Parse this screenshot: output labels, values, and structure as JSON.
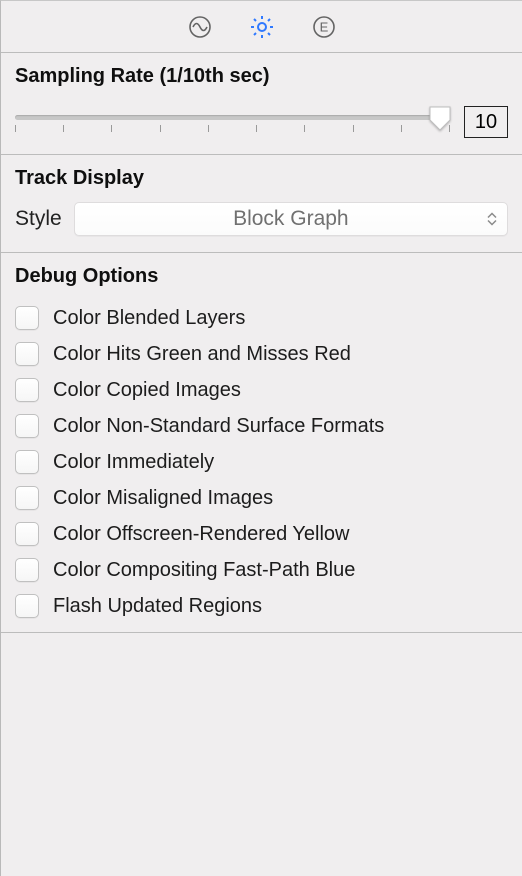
{
  "toolbar": {
    "tabs": [
      {
        "name": "wave-icon",
        "active": false
      },
      {
        "name": "gear-icon",
        "active": true
      },
      {
        "name": "circled-e-icon",
        "active": false
      }
    ]
  },
  "sampling": {
    "heading": "Sampling Rate (1/10th sec)",
    "tick_count": 10,
    "value": "10",
    "slider_position": 1.0
  },
  "track_display": {
    "heading": "Track Display",
    "style_label": "Style",
    "selected": "Block Graph"
  },
  "debug": {
    "heading": "Debug Options",
    "items": [
      "Color Blended Layers",
      "Color Hits Green and Misses Red",
      "Color Copied Images",
      "Color Non-Standard Surface Formats",
      "Color Immediately",
      "Color Misaligned Images",
      "Color Offscreen-Rendered Yellow",
      "Color Compositing Fast-Path Blue",
      "Flash Updated Regions"
    ]
  }
}
